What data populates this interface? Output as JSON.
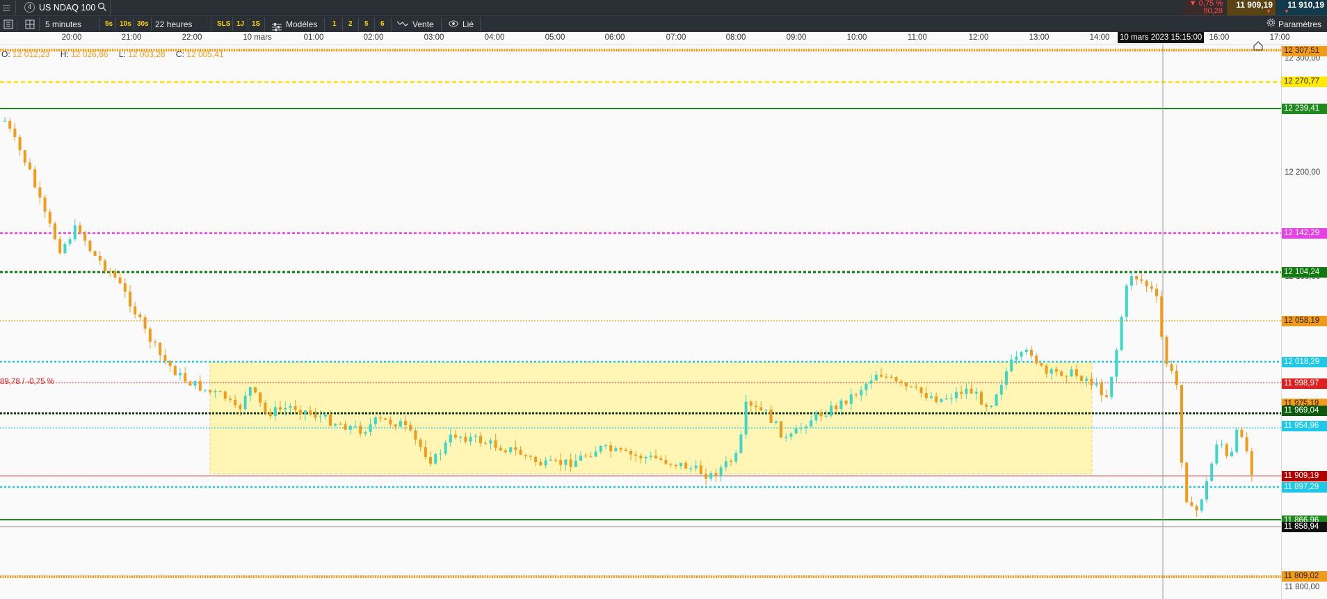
{
  "topbar": {
    "instrument_number": "4",
    "instrument_name": "US NDAQ 100",
    "change_pct": "▼ 0,75 %",
    "change_pts": "90,28",
    "bid": "11 909,19",
    "ask": "11 910,19"
  },
  "toolbar": {
    "timeframe": "5 minutes",
    "quick_intervals": [
      "5s",
      "10s",
      "30s"
    ],
    "period": "22 heures",
    "sls_label": "SLS",
    "short_periods": [
      "1J",
      "1S"
    ],
    "templates_label": "Modèles",
    "numbers": [
      "1",
      "2",
      "5",
      "6"
    ],
    "sell_label": "Vente",
    "linked_label": "Lié",
    "settings_label": "Paramètres"
  },
  "time_axis": {
    "labels": [
      "20:00",
      "21:00",
      "22:00",
      "10 mars",
      "01:00",
      "02:00",
      "03:00",
      "04:00",
      "05:00",
      "06:00",
      "07:00",
      "08:00",
      "09:00",
      "10:00",
      "11:00",
      "12:00",
      "13:00",
      "14:00",
      "16:00",
      "17:00"
    ],
    "cursor_label": "10 mars 2023 15:15:00"
  },
  "ohlc": {
    "o_label": "O:",
    "o_value": "12 012,23",
    "h_label": "H:",
    "h_value": "12 026,86",
    "l_label": "L:",
    "l_value": "12 003,28",
    "c_label": "C:",
    "c_value": "12 005,41"
  },
  "prev_close_label": "89,78 / -0,75 %",
  "price_axis": {
    "ticks": [
      "12 300,00",
      "12 200,00",
      "12 100,00",
      "11 800,00"
    ],
    "tags": [
      {
        "text": "12 307,51",
        "bg": "#f29b1a",
        "color": "#222"
      },
      {
        "text": "12 270,77",
        "bg": "#ffea00",
        "color": "#222"
      },
      {
        "text": "12 239,41",
        "bg": "#1e8a1e",
        "color": "#fff"
      },
      {
        "text": "12 142,29",
        "bg": "#e640e6",
        "color": "#fff"
      },
      {
        "text": "12 104,24",
        "bg": "#0d7a0d",
        "color": "#fff"
      },
      {
        "text": "12 058,19",
        "bg": "#f29b1a",
        "color": "#222"
      },
      {
        "text": "12 018,29",
        "bg": "#1ec8e8",
        "color": "#fff"
      },
      {
        "text": "11 998,97",
        "bg": "#e02020",
        "color": "#fff"
      },
      {
        "text": "11 975,19",
        "bg": "#f29b1a",
        "color": "#222"
      },
      {
        "text": "11 969,04",
        "bg": "#0d5a0d",
        "color": "#fff"
      },
      {
        "text": "11 954,96",
        "bg": "#1ec8e8",
        "color": "#fff"
      },
      {
        "text": "11 909,19",
        "bg": "#b00000",
        "color": "#fff"
      },
      {
        "text": "11 897,29",
        "bg": "#1ec8e8",
        "color": "#fff"
      },
      {
        "text": "11 866,96",
        "bg": "#1e8a1e",
        "color": "#fff"
      },
      {
        "text": "11 858,94",
        "bg": "#111111",
        "color": "#fff"
      },
      {
        "text": "11 809,02",
        "bg": "#f29b1a",
        "color": "#222"
      }
    ]
  },
  "colors": {
    "bull": "#3ed6c8",
    "bear": "#f29b1a",
    "zone": "#fff5b5"
  }
}
